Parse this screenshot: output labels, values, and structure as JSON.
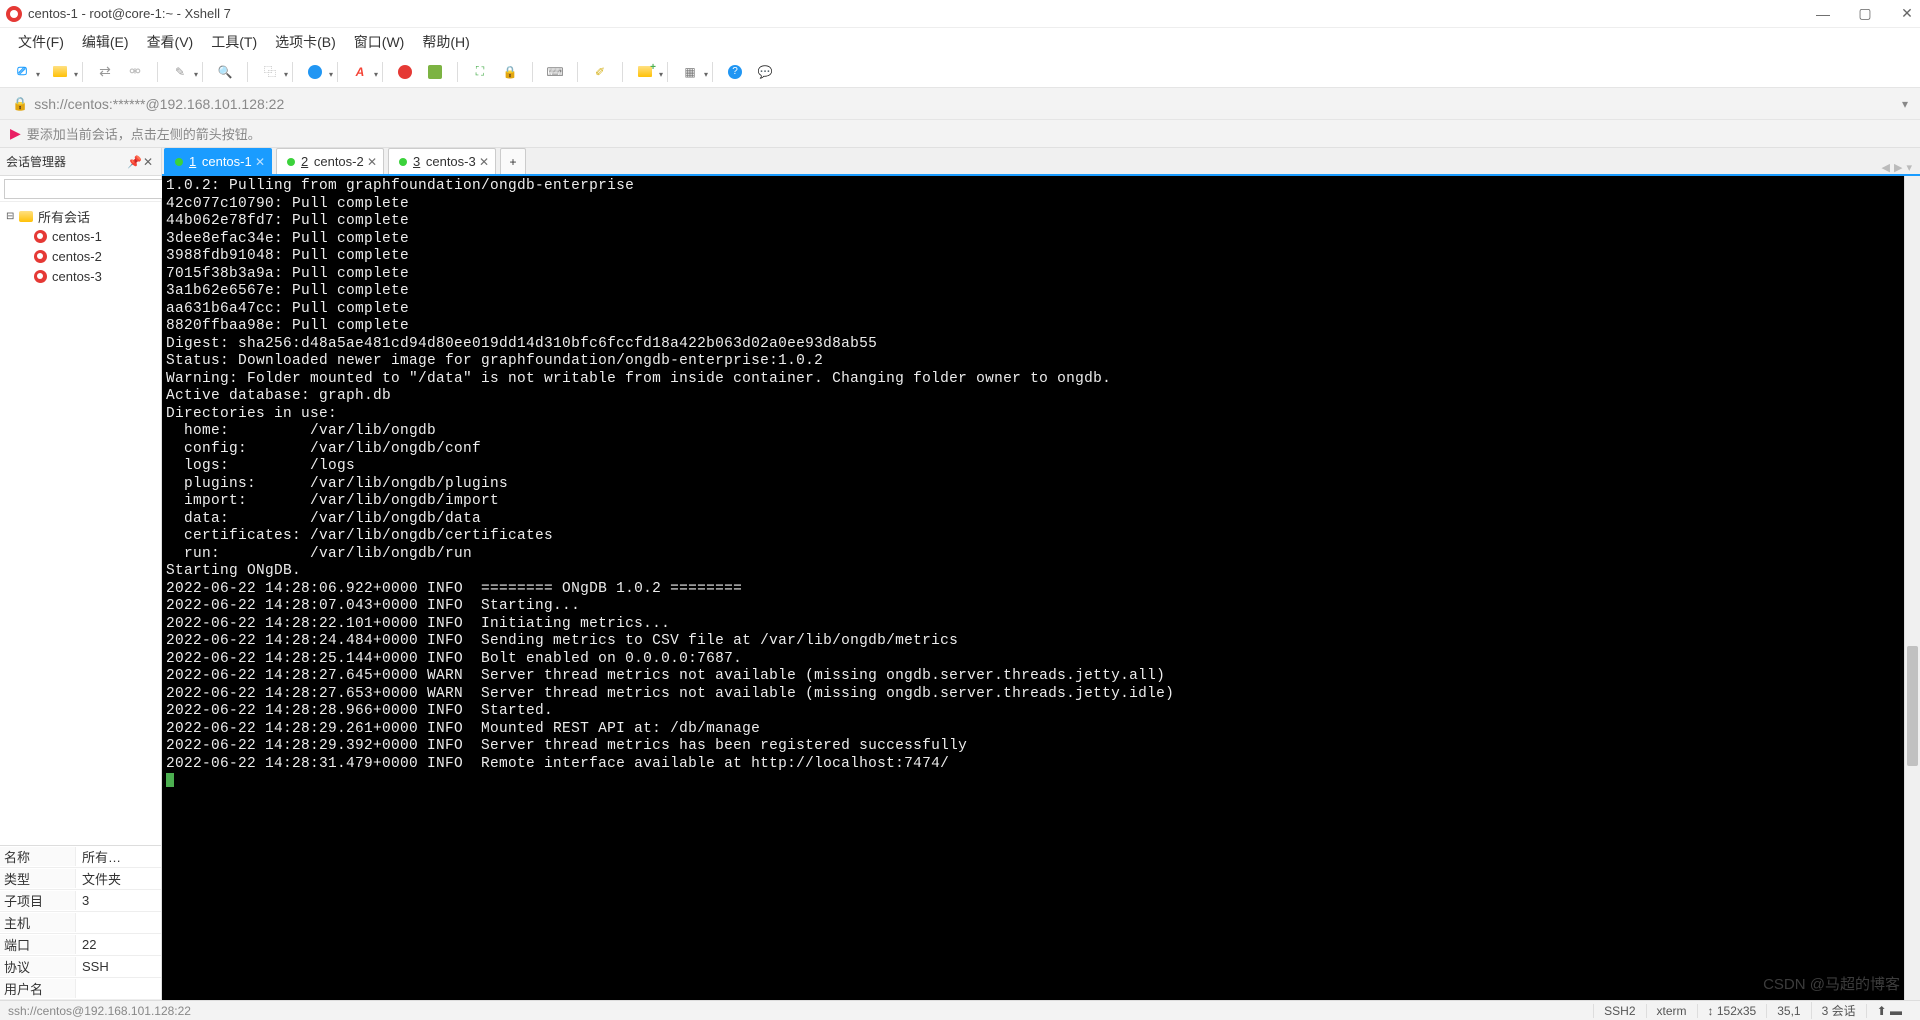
{
  "window": {
    "title": "centos-1 - root@core-1:~ - Xshell 7"
  },
  "menu": {
    "file": "文件(F)",
    "edit": "编辑(E)",
    "view": "查看(V)",
    "tools": "工具(T)",
    "tabs": "选项卡(B)",
    "window": "窗口(W)",
    "help": "帮助(H)"
  },
  "address": {
    "url": "ssh://centos:******@192.168.101.128:22"
  },
  "infobar": {
    "msg": "要添加当前会话，点击左侧的箭头按钮。"
  },
  "sidebar": {
    "title": "会话管理器",
    "root": "所有会话",
    "items": [
      "centos-1",
      "centos-2",
      "centos-3"
    ],
    "props": {
      "name_k": "名称",
      "name_v": "所有…",
      "type_k": "类型",
      "type_v": "文件夹",
      "sub_k": "子项目",
      "sub_v": "3",
      "host_k": "主机",
      "host_v": "",
      "port_k": "端口",
      "port_v": "22",
      "proto_k": "协议",
      "proto_v": "SSH",
      "user_k": "用户名",
      "user_v": ""
    }
  },
  "tabs": [
    {
      "num": "1",
      "label": "centos-1",
      "active": true
    },
    {
      "num": "2",
      "label": "centos-2",
      "active": false
    },
    {
      "num": "3",
      "label": "centos-3",
      "active": false
    }
  ],
  "terminal": "1.0.2: Pulling from graphfoundation/ongdb-enterprise\n42c077c10790: Pull complete\n44b062e78fd7: Pull complete\n3dee8efac34e: Pull complete\n3988fdb91048: Pull complete\n7015f38b3a9a: Pull complete\n3a1b62e6567e: Pull complete\naa631b6a47cc: Pull complete\n8820ffbaa98e: Pull complete\nDigest: sha256:d48a5ae481cd94d80ee019dd14d310bfc6fccfd18a422b063d02a0ee93d8ab55\nStatus: Downloaded newer image for graphfoundation/ongdb-enterprise:1.0.2\nWarning: Folder mounted to \"/data\" is not writable from inside container. Changing folder owner to ongdb.\nActive database: graph.db\nDirectories in use:\n  home:         /var/lib/ongdb\n  config:       /var/lib/ongdb/conf\n  logs:         /logs\n  plugins:      /var/lib/ongdb/plugins\n  import:       /var/lib/ongdb/import\n  data:         /var/lib/ongdb/data\n  certificates: /var/lib/ongdb/certificates\n  run:          /var/lib/ongdb/run\nStarting ONgDB.\n2022-06-22 14:28:06.922+0000 INFO  ======== ONgDB 1.0.2 ========\n2022-06-22 14:28:07.043+0000 INFO  Starting...\n2022-06-22 14:28:22.101+0000 INFO  Initiating metrics...\n2022-06-22 14:28:24.484+0000 INFO  Sending metrics to CSV file at /var/lib/ongdb/metrics\n2022-06-22 14:28:25.144+0000 INFO  Bolt enabled on 0.0.0.0:7687.\n2022-06-22 14:28:27.645+0000 WARN  Server thread metrics not available (missing ongdb.server.threads.jetty.all)\n2022-06-22 14:28:27.653+0000 WARN  Server thread metrics not available (missing ongdb.server.threads.jetty.idle)\n2022-06-22 14:28:28.966+0000 INFO  Started.\n2022-06-22 14:28:29.261+0000 INFO  Mounted REST API at: /db/manage\n2022-06-22 14:28:29.392+0000 INFO  Server thread metrics has been registered successfully\n2022-06-22 14:28:31.479+0000 INFO  Remote interface available at http://localhost:7474/",
  "status": {
    "left": "ssh://centos@192.168.101.128:22",
    "ssh": "SSH2",
    "term": "xterm",
    "size": "152x35",
    "pos": "35,1",
    "sessions": "3 会话"
  },
  "watermark": "CSDN @马超的博客"
}
